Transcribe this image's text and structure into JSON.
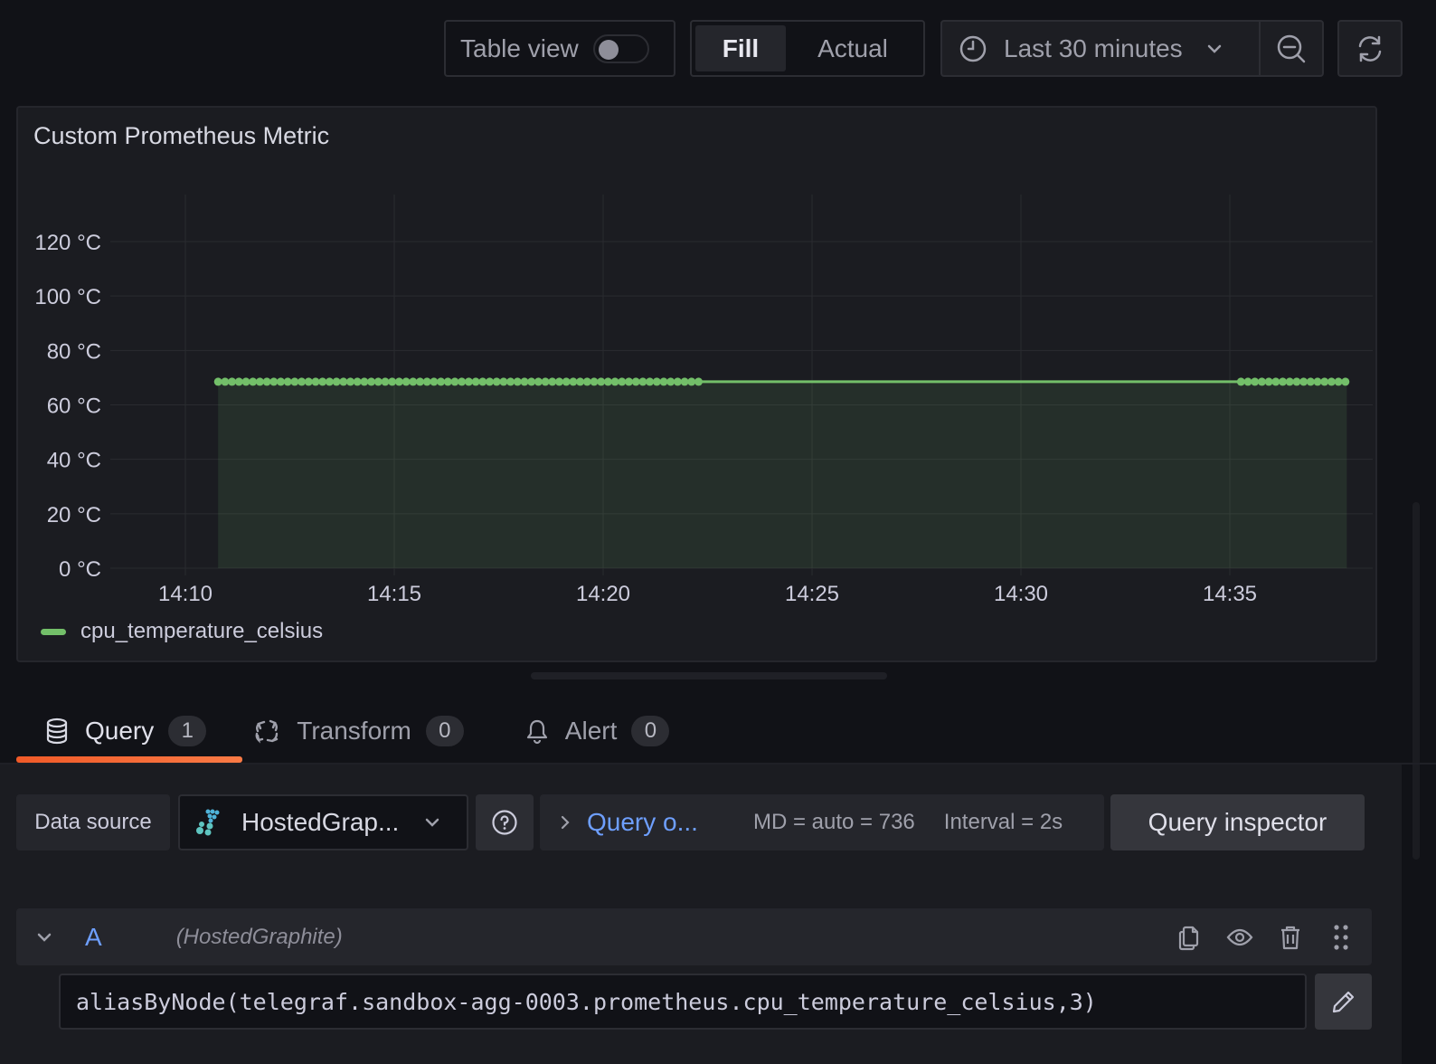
{
  "toolbar": {
    "table_view_label": "Table view",
    "table_view_on": false,
    "fill_label": "Fill",
    "actual_label": "Actual",
    "selected_mode": "Fill",
    "time_range_label": "Last 30 minutes",
    "icons": {
      "time": "clock-icon",
      "dropdown": "chevron-down-icon",
      "zoom_out": "zoom-out-icon",
      "refresh": "refresh-icon"
    }
  },
  "panel": {
    "title": "Custom Prometheus Metric"
  },
  "chart_data": {
    "type": "line",
    "title": "Custom Prometheus Metric",
    "xlabel": "",
    "ylabel": "",
    "y_unit": "°C",
    "ylim": [
      0,
      120
    ],
    "y_ticks": [
      "0 °C",
      "20 °C",
      "40 °C",
      "60 °C",
      "80 °C",
      "100 °C",
      "120 °C"
    ],
    "y_tick_values": [
      0,
      20,
      40,
      60,
      80,
      100,
      120
    ],
    "x_range": [
      "14:08:30",
      "14:38:30"
    ],
    "x_ticks": [
      "14:10",
      "14:15",
      "14:20",
      "14:25",
      "14:30",
      "14:35"
    ],
    "grid": true,
    "fill_area": true,
    "legend_position": "bottom-left",
    "series": [
      {
        "name": "cpu_temperature_celsius",
        "color": "#73bf69",
        "value": 68.5,
        "point_segments": [
          {
            "start": "14:10:47",
            "end": "14:22:19",
            "step_seconds": 10
          },
          {
            "start": "14:35:16",
            "end": "14:37:48",
            "step_seconds": 10
          }
        ],
        "line_segment": {
          "start": "14:10:47",
          "end": "14:37:48"
        }
      }
    ]
  },
  "tabs": [
    {
      "label": "Query",
      "count": "1",
      "icon": "database-icon",
      "active": true
    },
    {
      "label": "Transform",
      "count": "0",
      "icon": "transform-icon",
      "active": false
    },
    {
      "label": "Alert",
      "count": "0",
      "icon": "bell-icon",
      "active": false
    }
  ],
  "query_options": {
    "data_source_label": "Data source",
    "data_source_value": "HostedGrap...",
    "query_options_label": "Query o...",
    "max_data_points": "MD = auto = 736",
    "interval": "Interval = 2s",
    "query_inspector_label": "Query inspector"
  },
  "query": {
    "ref_id": "A",
    "datasource_name": "(HostedGraphite)",
    "expression": "aliasByNode(telegraf.sandbox-agg-0003.prometheus.cpu_temperature_celsius,3)"
  }
}
